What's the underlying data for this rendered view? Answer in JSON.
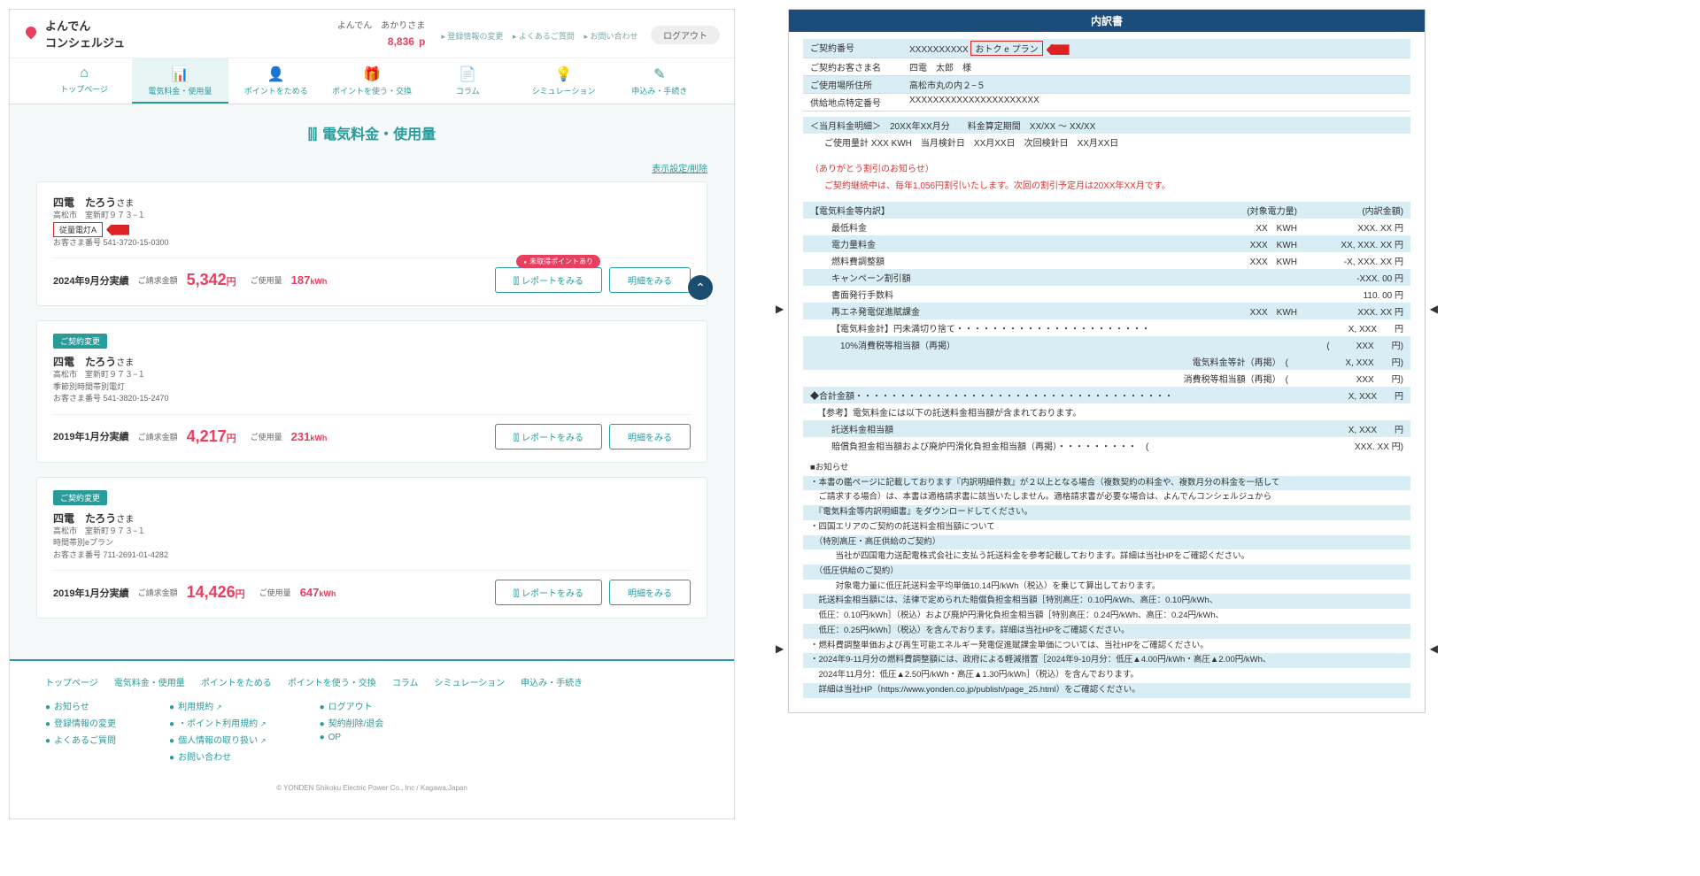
{
  "header": {
    "brand1": "よんでん",
    "brand2": "コンシェルジュ",
    "user_line": "よんでん　あかりさま",
    "points_value": "8,836",
    "points_unit": "p",
    "link_reg": "登録情報の変更",
    "link_faq": "よくあるご質問",
    "link_contact": "お問い合わせ",
    "logout": "ログアウト"
  },
  "nav": {
    "items": [
      {
        "icon": "⌂",
        "label": "トップページ"
      },
      {
        "icon": "📊",
        "label": "電気料金・使用量"
      },
      {
        "icon": "👤",
        "label": "ポイントをためる"
      },
      {
        "icon": "🎁",
        "label": "ポイントを使う・交換"
      },
      {
        "icon": "📄",
        "label": "コラム"
      },
      {
        "icon": "💡",
        "label": "シミュレーション"
      },
      {
        "icon": "✎",
        "label": "申込み・手続き"
      }
    ],
    "active_index": 1
  },
  "main": {
    "title": "電気料金・使用量",
    "settings_link": "表示設定/削除",
    "point_pill": "未取得ポイントあり",
    "btn_report": "レポートをみる",
    "btn_detail": "明細をみる",
    "change_badge": "ご契約変更",
    "sama": "さま",
    "cards": [
      {
        "name": "四電　たろう",
        "addr": "高松市　室新町９７３−１",
        "plan_badge": "従量電灯A",
        "show_arrow": true,
        "custno_label": "お客さま番号",
        "custno": "541-3720-15-0300",
        "period": "2024年9月分実績",
        "amt_label": "ご請求金額",
        "amt": "5,342",
        "amt_unit": "円",
        "usage_label": "ご使用量",
        "usage": "187",
        "usage_unit": "kWh",
        "show_change": false,
        "show_point_pill": true
      },
      {
        "name": "四電　たろう",
        "addr": "高松市　室新町９７３−１",
        "plan_text": "季節別時間帯別電灯",
        "custno_label": "お客さま番号",
        "custno": "541-3820-15-2470",
        "period": "2019年1月分実績",
        "amt_label": "ご請求金額",
        "amt": "4,217",
        "amt_unit": "円",
        "usage_label": "ご使用量",
        "usage": "231",
        "usage_unit": "kWh",
        "show_change": true
      },
      {
        "name": "四電　たろう",
        "addr": "高松市　室新町９７３−１",
        "plan_text": "時間帯別eプラン",
        "custno_label": "お客さま番号",
        "custno": "711-2691-01-4282",
        "period": "2019年1月分実績",
        "amt_label": "ご請求金額",
        "amt": "14,426",
        "amt_unit": "円",
        "usage_label": "ご使用量",
        "usage": "647",
        "usage_unit": "kWh",
        "show_change": true
      }
    ]
  },
  "footer": {
    "nav": [
      "トップページ",
      "電気料金・使用量",
      "ポイントをためる",
      "ポイントを使う・交換",
      "コラム",
      "シミュレーション",
      "申込み・手続き"
    ],
    "col1": [
      "お知らせ",
      "登録情報の変更",
      "よくあるご質問"
    ],
    "col2": [
      {
        "t": "利用規約",
        "ext": true
      },
      {
        "t2": "・ポイント利用規約",
        "ext": true
      },
      {
        "t": "個人情報の取り扱い",
        "ext": true
      },
      {
        "t": "お問い合わせ"
      }
    ],
    "col3": [
      "ログアウト",
      "契約削除/退会",
      "OP"
    ],
    "copy": "© YONDEN Shikoku Electric Power Co., Inc / Kagawa,Japan"
  },
  "doc": {
    "title": "内訳書",
    "rows": [
      {
        "lab": "ご契約番号",
        "val": "XXXXXXXXXX",
        "plan": "おトク e プラン",
        "arrow": true
      },
      {
        "lab": "ご契約お客さま名",
        "val": "四電　太郎　様"
      },
      {
        "lab": "ご使用場所住所",
        "val": "高松市丸の内２−５"
      },
      {
        "lab": "供給地点特定番号",
        "val": "XXXXXXXXXXXXXXXXXXXXXX"
      }
    ],
    "month_line": "＜当月料金明細＞　20XX年XX月分　　料金算定期間　XX/XX  ～  XX/XX",
    "usage_line": "ご使用量計 XXX KWH　当月検針日　XX月XX日　次回検針日　XX月XX日",
    "thank_title": "（ありがとう割引のお知らせ）",
    "thank_body": "ご契約継続中は、毎年1,056円割引いたします。次回の割引予定月は20XX年XX月です。",
    "break_title": "【電気料金等内訳】",
    "hdr_qty": "(対象電力量)",
    "hdr_amt": "(内訳金額)",
    "lines": [
      {
        "c1": "最低料金",
        "c2": "XX　KWH",
        "c3": "XXX. XX 円"
      },
      {
        "c1": "電力量料金",
        "c2": "XXX　KWH",
        "c3": "XX, XXX. XX 円"
      },
      {
        "c1": "燃料費調整額",
        "c2": "XXX　KWH",
        "c3": "-X, XXX. XX 円"
      },
      {
        "c1": "キャンペーン割引額",
        "c2": "",
        "c3": "-XXX. 00 円"
      },
      {
        "c1": "書面発行手数料",
        "c2": "",
        "c3": "110. 00 円"
      },
      {
        "c1": "再エネ発電促進賦課金",
        "c2": "XXX　KWH",
        "c3": "XXX. XX 円"
      },
      {
        "c1": "【電気料金計】円未満切り捨て・・・・・・・・・・・・・・・・・・・・・・",
        "c2": "",
        "c3": "X, XXX　　円"
      },
      {
        "c1": "　10%消費税等相当額（再掲）",
        "c2": "",
        "c3": "(　　　XXX　　円)"
      }
    ],
    "sub_lines": [
      {
        "c1": "電気料金等計（再掲）",
        "paren": "(",
        "c3": "X, XXX　　円)"
      },
      {
        "c1": "消費税等相当額（再掲）",
        "paren": "(",
        "c3": "XXX　　円)"
      }
    ],
    "total": "◆合計金額・・・・・・・・・・・・・・・・・・・・・・・・・・・・・・・・・・・・",
    "total_amt": "X, XXX　　円",
    "ref_title": "【参考】電気料金には以下の託送料金相当額が含まれております。",
    "ref_lines": [
      {
        "c1": "託送料金相当額",
        "c3": "X, XXX　　円"
      },
      {
        "c1": "賠償負担金相当額および廃炉円滑化負担金相当額（再掲）・・・・・・・・・　(",
        "c3": "XXX. XX 円)"
      }
    ],
    "notice_title": "■お知らせ",
    "notices": [
      "・本書の鑑ページに記載しております『内訳明細件数』が２以上となる場合（複数契約の料金や、複数月分の料金を一括して",
      "　ご請求する場合）は、本書は適格請求書に該当いたしません。適格請求書が必要な場合は、よんでんコンシェルジュから",
      "　『電気料金等内訳明細書』をダウンロードしてください。",
      "・四国エリアのご契約の託送料金相当額について",
      "　（特別高圧・高圧供給のご契約）",
      "　　　当社が四国電力送配電株式会社に支払う託送料金を参考記載しております。詳細は当社HPをご確認ください。",
      "　（低圧供給のご契約）",
      "　　　対象電力量に低圧託送料金平均単価10.14円/kWh（税込）を乗じて算出しております。",
      "　託送料金相当額には、法律で定められた賠償負担金相当額［特別高圧：0.10円/kWh、高圧：0.10円/kWh、",
      "　低圧：0.10円/kWh］（税込）および廃炉円滑化負担金相当額［特別高圧：0.24円/kWh、高圧：0.24円/kWh、",
      "　低圧：0.25円/kWh］（税込）を含んでおります。詳細は当社HPをご確認ください。",
      "・燃料費調整単価および再生可能エネルギー発電促進賦課金単価については、当社HPをご確認ください。",
      "・2024年9-11月分の燃料費調整額には、政府による軽減措置［2024年9-10月分：低圧▲4.00円/kWh・高圧▲2.00円/kWh、",
      "　2024年11月分：低圧▲2.50円/kWh・高圧▲1.30円/kWh］（税込）を含んでおります。",
      "　詳細は当社HP（https://www.yonden.co.jp/publish/page_25.html）をご確認ください。"
    ]
  }
}
